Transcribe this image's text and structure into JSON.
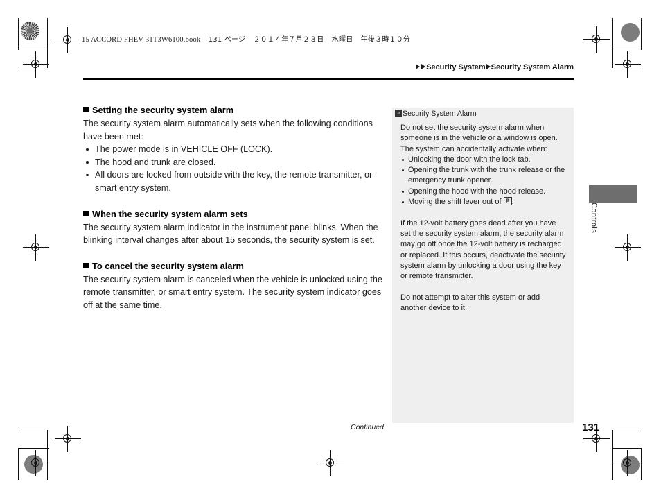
{
  "print_header": {
    "file_line": "15 ACCORD FHEV-31T3W6100.book",
    "page_marker": "131 ページ",
    "date_jp": "２０１４年７月２３日",
    "weekday_jp": "水曜日",
    "time_jp": "午後３時１０分"
  },
  "breadcrumb": {
    "level1": "Security System",
    "level2": "Security System Alarm"
  },
  "sections": [
    {
      "heading": "Setting the security system alarm",
      "paragraph": "The security system alarm automatically sets when the following conditions have been met:",
      "bullets": [
        "The power mode is in VEHICLE OFF (LOCK).",
        "The hood and trunk are closed.",
        "All doors are locked from outside with the key, the remote transmitter, or smart entry system."
      ]
    },
    {
      "heading": "When the security system alarm sets",
      "paragraph": "The security system alarm indicator in the instrument panel blinks. When the blinking interval changes after about 15 seconds, the security system is set.",
      "bullets": []
    },
    {
      "heading": "To cancel the security system alarm",
      "paragraph": "The security system alarm is canceled when the vehicle is unlocked using the remote transmitter, or smart entry system. The security system indicator goes off at the same time.",
      "bullets": []
    }
  ],
  "panel": {
    "title": "Security System Alarm",
    "intro": "Do not set the security system alarm when someone is in the vehicle or a window is open. The system can accidentally activate when:",
    "bullets": [
      "Unlocking the door with the lock tab.",
      "Opening the trunk with the trunk release or the emergency trunk opener.",
      "Opening the hood with the hood release."
    ],
    "bullet_shift_prefix": "Moving the shift lever out of",
    "bullet_shift_box": "P",
    "bullet_shift_suffix": ".",
    "note1": "If the 12-volt battery goes dead after you have set the security system alarm, the security alarm may go off once the 12-volt battery is recharged or replaced. If this occurs, deactivate the security system alarm by unlocking a door using the key or remote transmitter.",
    "note2": "Do not attempt to alter this system or add another device to it."
  },
  "thumb_tab": {
    "label": "Controls"
  },
  "footer": {
    "continued": "Continued",
    "page_number": "131"
  }
}
